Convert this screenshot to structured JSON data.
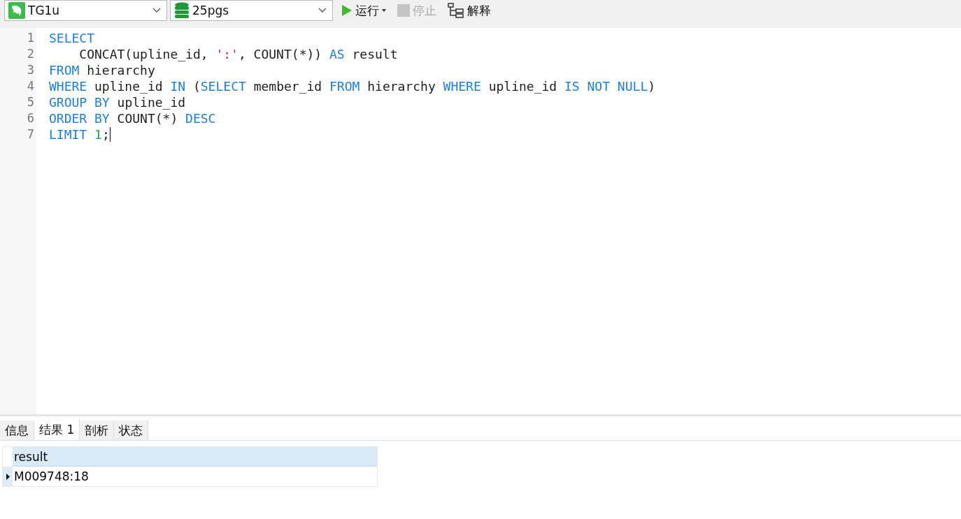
{
  "toolbar": {
    "connection": {
      "value": "TG1u"
    },
    "database": {
      "value": "25pgs"
    },
    "buttons": [
      {
        "label": "运行",
        "kind": "run",
        "disabled": false
      },
      {
        "label": "停止",
        "kind": "stop",
        "disabled": true
      },
      {
        "label": "解释",
        "kind": "explain",
        "disabled": false
      }
    ]
  },
  "editor": {
    "lines": [
      {
        "number": "1",
        "tokens": [
          {
            "text": "SELECT",
            "kind": "keyword"
          }
        ]
      },
      {
        "number": "2",
        "tokens": [
          {
            "text": "    CONCAT(upline_id, ",
            "kind": "plain"
          },
          {
            "text": "':'",
            "kind": "string"
          },
          {
            "text": ", COUNT(*)) ",
            "kind": "plain"
          },
          {
            "text": "AS",
            "kind": "keyword"
          },
          {
            "text": " result",
            "kind": "plain"
          }
        ]
      },
      {
        "number": "3",
        "tokens": [
          {
            "text": "FROM",
            "kind": "keyword"
          },
          {
            "text": " hierarchy",
            "kind": "plain"
          }
        ]
      },
      {
        "number": "4",
        "tokens": [
          {
            "text": "WHERE",
            "kind": "keyword"
          },
          {
            "text": " upline_id ",
            "kind": "plain"
          },
          {
            "text": "IN",
            "kind": "keyword"
          },
          {
            "text": " (",
            "kind": "plain"
          },
          {
            "text": "SELECT",
            "kind": "keyword"
          },
          {
            "text": " member_id ",
            "kind": "plain"
          },
          {
            "text": "FROM",
            "kind": "keyword"
          },
          {
            "text": " hierarchy ",
            "kind": "plain"
          },
          {
            "text": "WHERE",
            "kind": "keyword"
          },
          {
            "text": " upline_id ",
            "kind": "plain"
          },
          {
            "text": "IS NOT NULL",
            "kind": "keyword"
          },
          {
            "text": ")",
            "kind": "plain"
          }
        ]
      },
      {
        "number": "5",
        "tokens": [
          {
            "text": "GROUP BY",
            "kind": "keyword"
          },
          {
            "text": " upline_id",
            "kind": "plain"
          }
        ]
      },
      {
        "number": "6",
        "tokens": [
          {
            "text": "ORDER BY",
            "kind": "keyword"
          },
          {
            "text": " COUNT(*) ",
            "kind": "plain"
          },
          {
            "text": "DESC",
            "kind": "keyword"
          }
        ]
      },
      {
        "number": "7",
        "tokens": [
          {
            "text": "LIMIT ",
            "kind": "keyword"
          },
          {
            "text": "1",
            "kind": "number"
          },
          {
            "text": ";",
            "kind": "plain"
          }
        ]
      }
    ]
  },
  "result_tabs": [
    {
      "label": "信息",
      "selected": false
    },
    {
      "label": "结果 1",
      "selected": true
    },
    {
      "label": "剖析",
      "selected": false
    },
    {
      "label": "状态",
      "selected": false
    }
  ],
  "table": {
    "columns": [
      "result"
    ],
    "rows": [
      {
        "cells": [
          "M009748:18"
        ],
        "selected": true
      }
    ]
  }
}
